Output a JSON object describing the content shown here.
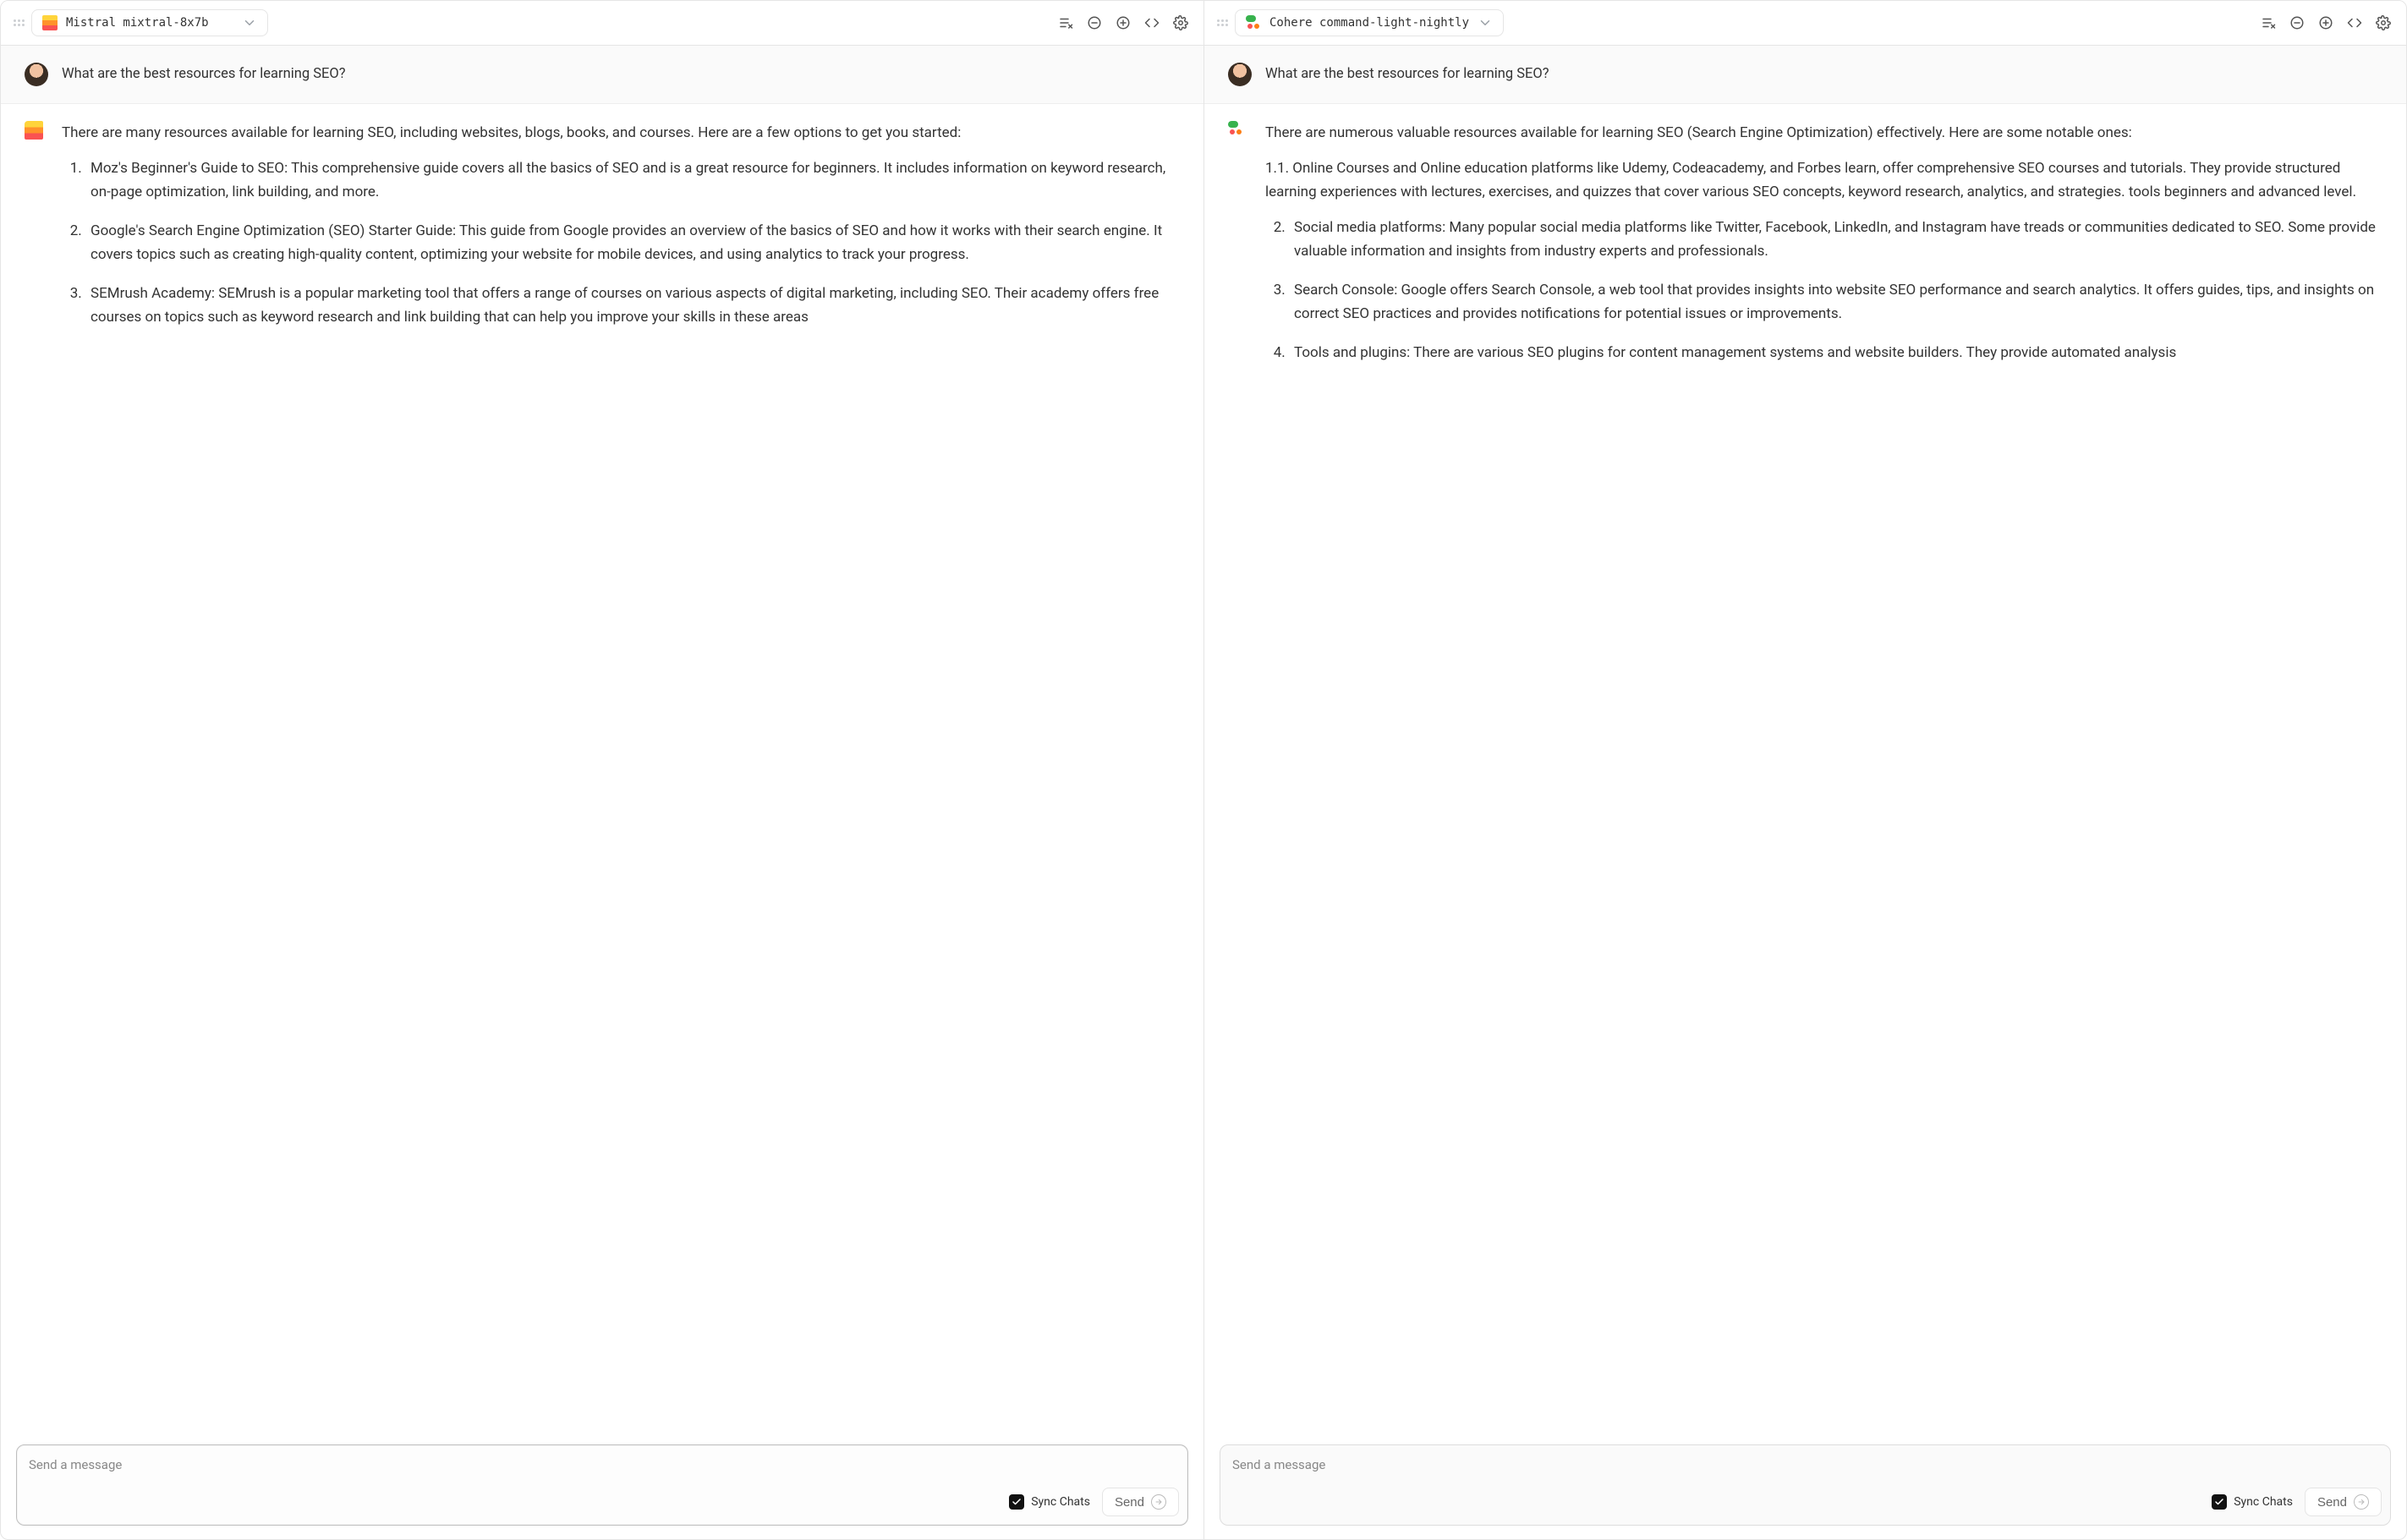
{
  "panels": [
    {
      "provider_icon": "mistral",
      "model_name": "Mistral mixtral-8x7b",
      "user_message": "What are the best resources for learning SEO?",
      "assistant_intro": "There are many resources available for learning SEO, including websites, blogs, books, and courses. Here are a few options to get you started:",
      "assistant_items": [
        "Moz's Beginner's Guide to SEO: This comprehensive guide covers all the basics of SEO and is a great resource for beginners. It includes information on keyword research, on-page optimization, link building, and more.",
        "Google's Search Engine Optimization (SEO) Starter Guide: This guide from Google provides an overview of the basics of SEO and how it works with their search engine. It covers topics such as creating high-quality content, optimizing your website for mobile devices, and using analytics to track your progress.",
        "SEMrush Academy: SEMrush is a popular marketing tool that offers a range of courses on various aspects of digital marketing, including SEO. Their academy offers free courses on topics such as keyword research and link building that can help you improve your skills in these areas"
      ],
      "composer_focused": true
    },
    {
      "provider_icon": "cohere",
      "model_name": "Cohere command-light-nightly",
      "user_message": "What are the best resources for learning SEO?",
      "assistant_intro": "There are numerous valuable resources available for learning SEO (Search Engine Optimization) effectively. Here are some notable ones:",
      "assistant_lead_paragraph": "1.1. Online Courses and Online education platforms like Udemy, Codeacademy, and Forbes learn, offer comprehensive SEO courses and tutorials. They provide structured learning experiences with lectures, exercises, and quizzes that cover various SEO concepts, keyword research, analytics, and strategies. tools beginners and advanced level.",
      "assistant_list_start": 2,
      "assistant_items": [
        "Social media platforms: Many popular social media platforms like Twitter, Facebook, LinkedIn, and Instagram have treads or communities dedicated to SEO. Some provide valuable information and insights from industry experts and professionals.",
        "Search Console: Google offers Search Console, a web tool that provides insights into website SEO performance and search analytics. It offers guides, tips, and insights on correct SEO practices and provides notifications for potential issues or improvements.",
        "Tools and plugins: There are various SEO plugins for content management systems and website builders. They provide automated analysis"
      ],
      "composer_focused": false
    }
  ],
  "composer": {
    "placeholder": "Send a message",
    "sync_label": "Sync Chats",
    "send_label": "Send"
  }
}
